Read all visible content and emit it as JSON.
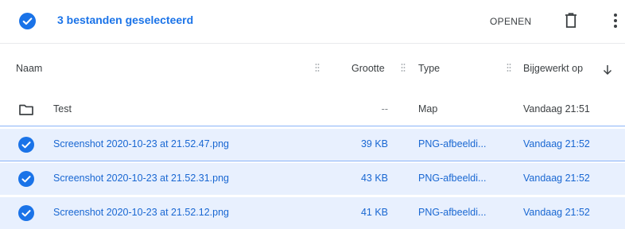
{
  "selection": {
    "title": "3 bestanden geselecteerd",
    "open_label": "OPENEN",
    "delete_icon": "trash-icon",
    "more_icon": "more-vert-icon"
  },
  "table": {
    "columns": {
      "name": "Naam",
      "size": "Grootte",
      "type": "Type",
      "modified": "Bijgewerkt op"
    },
    "sort_icon": "arrow-down-icon",
    "rows": [
      {
        "icon": "folder-icon",
        "name": "Test",
        "size": "--",
        "type": "Map",
        "modified": "Vandaag 21:51",
        "selected": false
      },
      {
        "icon": "check-circle-icon",
        "name": "Screenshot 2020-10-23 at 21.52.47.png",
        "size": "39 KB",
        "type": "PNG-afbeeldi...",
        "modified": "Vandaag 21:52",
        "selected": true
      },
      {
        "icon": "check-circle-icon",
        "name": "Screenshot 2020-10-23 at 21.52.31.png",
        "size": "43 KB",
        "type": "PNG-afbeeldi...",
        "modified": "Vandaag 21:52",
        "selected": true
      },
      {
        "icon": "check-circle-icon",
        "name": "Screenshot 2020-10-23 at 21.52.12.png",
        "size": "41 KB",
        "type": "PNG-afbeeldi...",
        "modified": "Vandaag 21:52",
        "selected": true
      }
    ]
  },
  "colors": {
    "accent": "#1a73e8",
    "selected_background": "#e8f0fe",
    "selected_text": "#1967d2"
  }
}
